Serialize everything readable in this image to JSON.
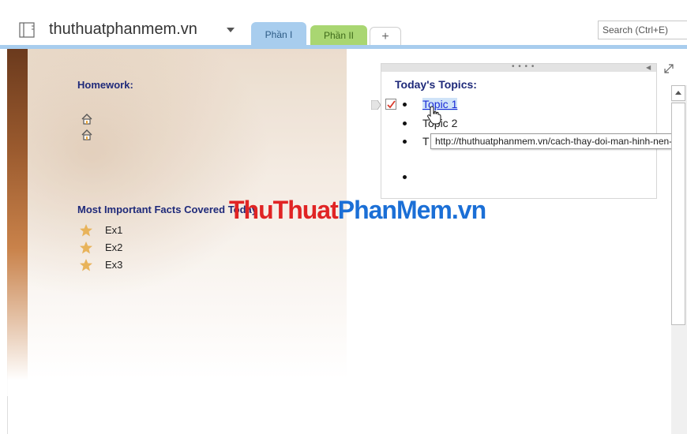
{
  "header": {
    "notebook_name": "thuthuatphanmem.vn",
    "tabs": [
      {
        "label": "Phần I",
        "color": "#a8cdee",
        "active": true
      },
      {
        "label": "Phần II",
        "color": "#a9d672",
        "active": false
      }
    ],
    "add_tab_label": "+",
    "search_placeholder": "Search (Ctrl+E)"
  },
  "page": {
    "homework_title": "Homework:",
    "homework_icons": [
      "house-icon",
      "house-icon"
    ],
    "facts_title": "Most Important Facts Covered Today",
    "facts": [
      {
        "label": "Ex1",
        "icon": "star-icon"
      },
      {
        "label": "Ex2",
        "icon": "star-icon"
      },
      {
        "label": "Ex3",
        "icon": "star-icon"
      }
    ]
  },
  "topics": {
    "title": "Today's Topics:",
    "items": [
      "Topic 1",
      "Topic 2",
      "T"
    ],
    "tooltip": "http://thuthuatphanmem.vn/cach-thay-doi-man-hinh-nen-trong-onenote"
  },
  "watermark": {
    "part1": "ThuThuat",
    "part2": "PhanMem.vn"
  }
}
